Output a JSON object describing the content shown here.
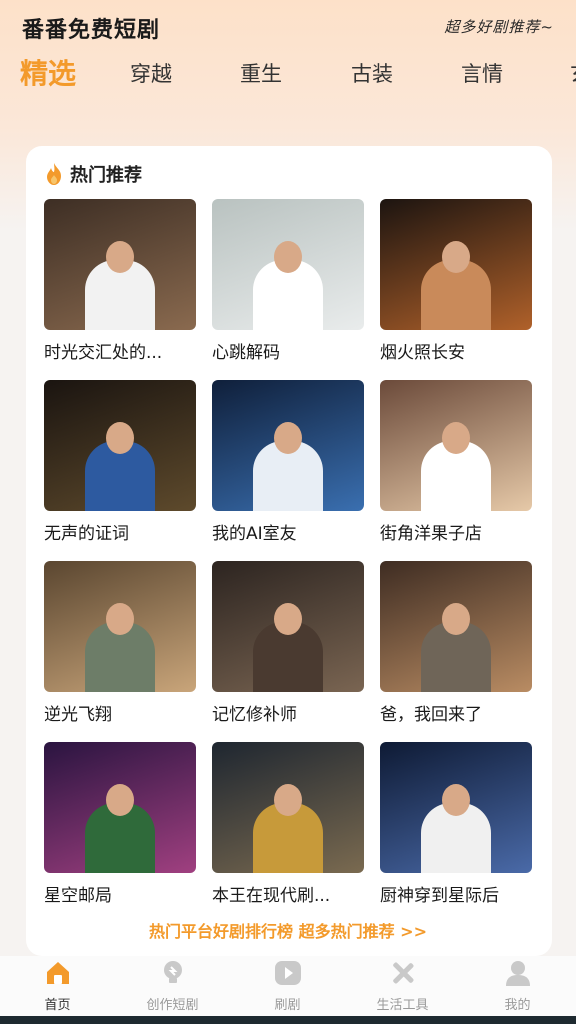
{
  "header": {
    "app_title": "番番免费短剧",
    "slogan": "超多好剧推荐~"
  },
  "tabs": [
    {
      "label": "精选",
      "active": true
    },
    {
      "label": "穿越",
      "active": false
    },
    {
      "label": "重生",
      "active": false
    },
    {
      "label": "古装",
      "active": false
    },
    {
      "label": "言情",
      "active": false
    },
    {
      "label": "玄",
      "active": false
    }
  ],
  "section": {
    "icon": "fire-icon",
    "title": "热门推荐"
  },
  "dramas": [
    {
      "title": "时光交汇处的...",
      "palette": [
        "#3d2e24",
        "#8a6a4f"
      ],
      "figure": "#f2f2f2"
    },
    {
      "title": "心跳解码",
      "palette": [
        "#b9c2c0",
        "#e9ecec"
      ],
      "figure": "#ffffff"
    },
    {
      "title": "烟火照长安",
      "palette": [
        "#1c1410",
        "#b0612a"
      ],
      "figure": "#c98a5a"
    },
    {
      "title": "无声的证词",
      "palette": [
        "#1a1410",
        "#5e4a2c"
      ],
      "figure": "#2d5aa0"
    },
    {
      "title": "我的AI室友",
      "palette": [
        "#0f1f3a",
        "#3a6fb0"
      ],
      "figure": "#e8eef5"
    },
    {
      "title": "街角洋果子店",
      "palette": [
        "#6b4a3a",
        "#e6c9a8"
      ],
      "figure": "#ffffff"
    },
    {
      "title": "逆光飞翔",
      "palette": [
        "#5a4630",
        "#c9a57a"
      ],
      "figure": "#6d7d68"
    },
    {
      "title": "记忆修补师",
      "palette": [
        "#2c2420",
        "#7a6552"
      ],
      "figure": "#4a3a30"
    },
    {
      "title": "爸，我回来了",
      "palette": [
        "#3e2c22",
        "#b98c63"
      ],
      "figure": "#6f6558"
    },
    {
      "title": "星空邮局",
      "palette": [
        "#2a1440",
        "#a04080"
      ],
      "figure": "#2f6a3a"
    },
    {
      "title": "本王在现代刷...",
      "palette": [
        "#1e2630",
        "#7a6a50"
      ],
      "figure": "#c79a3a"
    },
    {
      "title": "厨神穿到星际后",
      "palette": [
        "#0e1a34",
        "#4a6aa8"
      ],
      "figure": "#f0f0f0"
    }
  ],
  "promo": {
    "text": "热门平台好剧排行榜 超多热门推荐 >>"
  },
  "nav": [
    {
      "label": "首页",
      "icon": "home-icon",
      "active": true
    },
    {
      "label": "创作短剧",
      "icon": "bulb-icon",
      "active": false
    },
    {
      "label": "刷剧",
      "icon": "play-icon",
      "active": false
    },
    {
      "label": "生活工具",
      "icon": "tools-icon",
      "active": false
    },
    {
      "label": "我的",
      "icon": "user-icon",
      "active": false
    }
  ],
  "colors": {
    "accent": "#f39a2b",
    "text": "#1a1a1a",
    "muted": "#9a9a9a"
  }
}
